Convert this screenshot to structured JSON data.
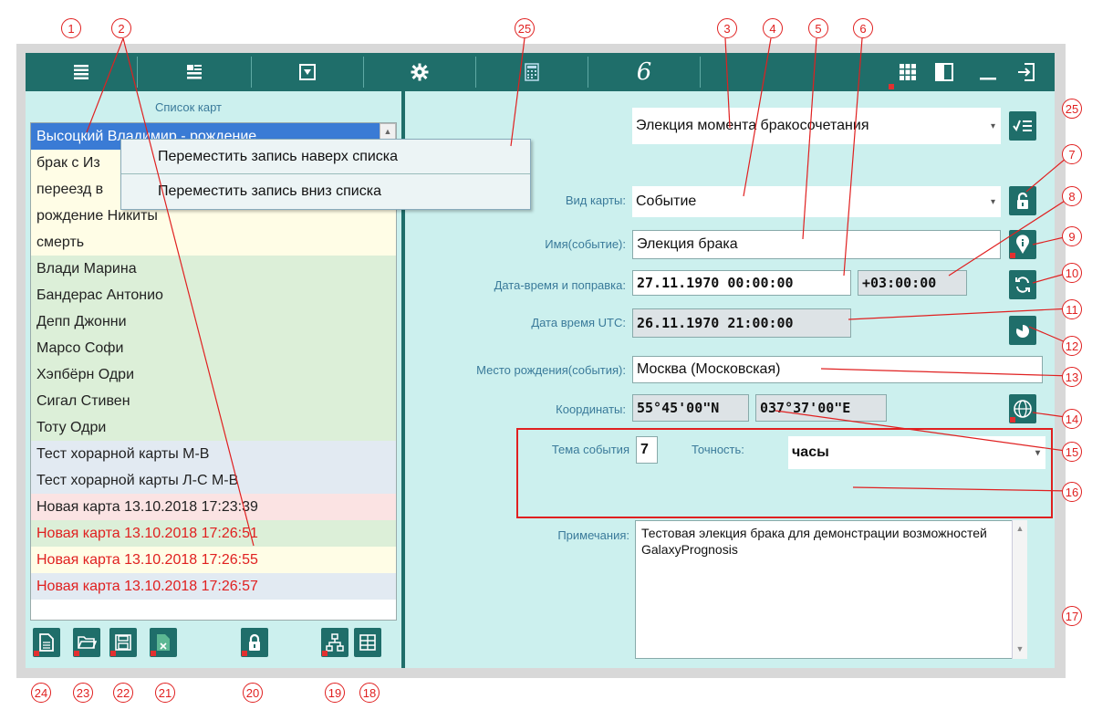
{
  "toolbar": {
    "icons": [
      "list-icon",
      "card-list-icon",
      "dropdown-icon",
      "gear-icon",
      "calculator-icon",
      "script-icon",
      "grid-icon",
      "panel-icon",
      "minimize-icon",
      "exit-icon"
    ],
    "script_glyph": "6"
  },
  "left": {
    "title": "Список карт",
    "rows": [
      {
        "text": "Высоцкий Владимир - рождение",
        "bg": "#3a7bd5",
        "color": "#ffffff"
      },
      {
        "text": "брак с Из",
        "bg": "#fffde6",
        "color": "#222222"
      },
      {
        "text": "переезд в",
        "bg": "#fffde6",
        "color": "#222222"
      },
      {
        "text": "рождение Никиты",
        "bg": "#fffde6",
        "color": "#222222"
      },
      {
        "text": "смерть",
        "bg": "#fffde6",
        "color": "#222222"
      },
      {
        "text": "Влади Марина",
        "bg": "#dcefd8",
        "color": "#222222"
      },
      {
        "text": "Бандерас Антонио",
        "bg": "#dcefd8",
        "color": "#222222"
      },
      {
        "text": "Депп Джонни",
        "bg": "#dcefd8",
        "color": "#222222"
      },
      {
        "text": "Марсо Софи",
        "bg": "#dcefd8",
        "color": "#222222"
      },
      {
        "text": "Хэпбёрн Одри",
        "bg": "#dcefd8",
        "color": "#222222"
      },
      {
        "text": "Сигал Стивен",
        "bg": "#dcefd8",
        "color": "#222222"
      },
      {
        "text": "Тоту Одри",
        "bg": "#dcefd8",
        "color": "#222222"
      },
      {
        "text": "Тест хорарной карты М-В",
        "bg": "#e2eaf2",
        "color": "#222222"
      },
      {
        "text": "Тест хорарной карты Л-С М-В",
        "bg": "#e2eaf2",
        "color": "#222222"
      },
      {
        "text": "Новая карта 13.10.2018 17:23:39",
        "bg": "#fbe3e3",
        "color": "#222222"
      },
      {
        "text": "Новая карта 13.10.2018 17:26:51",
        "bg": "#dcefd8",
        "color": "#e02020"
      },
      {
        "text": "Новая карта 13.10.2018 17:26:55",
        "bg": "#fffde6",
        "color": "#e02020"
      },
      {
        "text": "Новая карта 13.10.2018 17:26:57",
        "bg": "#e2eaf2",
        "color": "#e02020"
      }
    ],
    "context_menu": [
      "Переместить запись наверх списка",
      "Переместить запись вниз списка"
    ],
    "bottom_icons": [
      "new-file-icon",
      "open-folder-icon",
      "save-icon",
      "delete-icon",
      "lock-icon",
      "tree-icon",
      "table-icon"
    ]
  },
  "right": {
    "election": "Элекция момента бракосочетания",
    "card_type_label": "Вид карты:",
    "card_type": "Событие",
    "name_label": "Имя(событие):",
    "name": "Элекция брака",
    "datetime_label": "Дата-время и поправка:",
    "datetime": "27.11.1970 00:00:00",
    "offset": "+03:00:00",
    "utc_label": "Дата время UTC:",
    "utc": "26.11.1970 21:00:00",
    "place_label": "Место рождения(события):",
    "place": "Москва (Московская)",
    "coords_label": "Координаты:",
    "lat": "55°45'00\"N",
    "lon": "037°37'00\"E",
    "theme_label": "Тема события",
    "theme": "7",
    "accuracy_label": "Точность:",
    "accuracy": "часы",
    "notes_label": "Примечания:",
    "notes": "Тестовая элекция брака для демонстрации возможностей GalaxyPrognosis"
  },
  "callouts": [
    "1",
    "2",
    "3",
    "4",
    "5",
    "6",
    "7",
    "8",
    "9",
    "10",
    "11",
    "12",
    "13",
    "14",
    "15",
    "16",
    "17",
    "18",
    "19",
    "20",
    "21",
    "22",
    "23",
    "24",
    "25"
  ],
  "colors": {
    "accent": "#1f6e6a",
    "panel": "#ccf0ee",
    "callout": "#e02020"
  }
}
